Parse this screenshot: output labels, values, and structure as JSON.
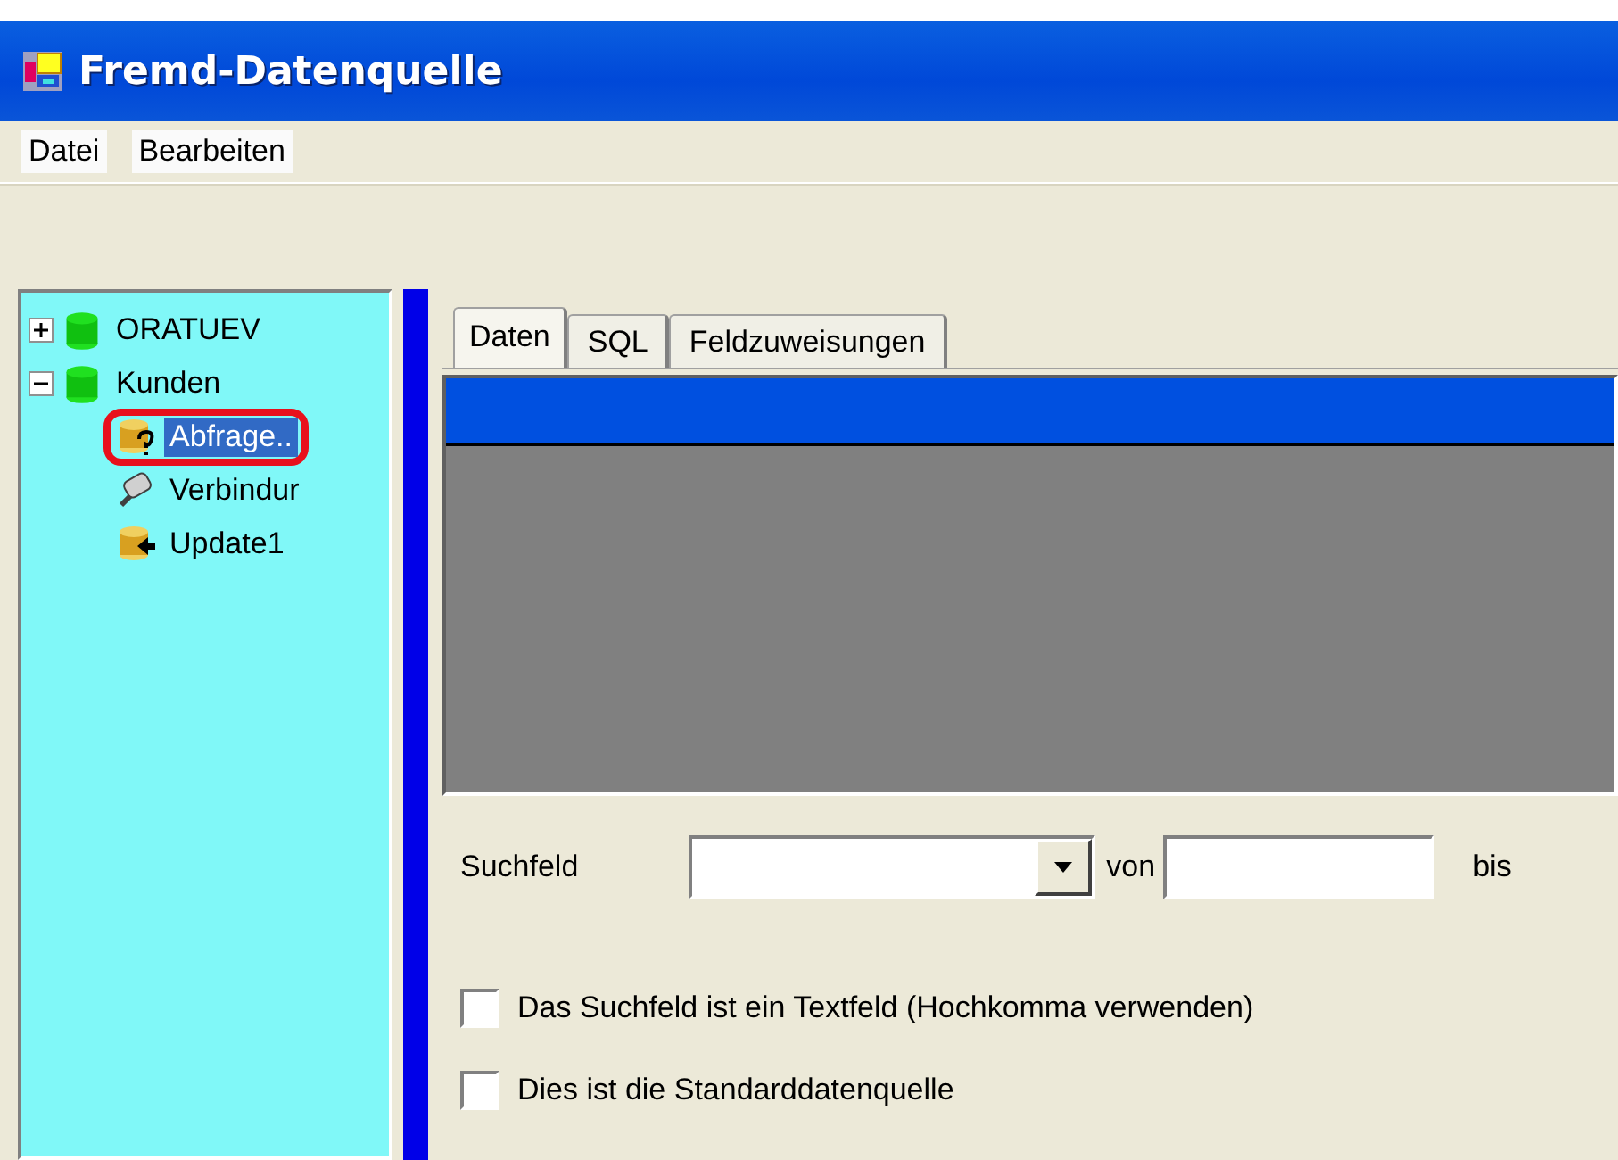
{
  "window": {
    "title": "Fremd-Datenquelle"
  },
  "menu": [
    "Datei",
    "Bearbeiten"
  ],
  "tree": [
    {
      "label": "ORATUEV",
      "kind": "database",
      "expanded": false,
      "selected": false
    },
    {
      "label": "Kunden",
      "kind": "database",
      "expanded": true,
      "selected": false,
      "children": [
        {
          "label": "Abfrage..",
          "kind": "query",
          "selected": true,
          "circled": true
        },
        {
          "label": "Verbindur",
          "kind": "connection",
          "selected": false,
          "circled": false
        },
        {
          "label": "Update1",
          "kind": "update",
          "selected": false,
          "circled": false
        }
      ]
    }
  ],
  "tabs": [
    {
      "label": "Daten",
      "selected": true
    },
    {
      "label": "SQL",
      "selected": false
    },
    {
      "label": "Feldzuweisungen",
      "selected": false
    }
  ],
  "search": {
    "label": "Suchfeld",
    "from_label": "von",
    "to_label": "bis"
  },
  "options": [
    {
      "label": "Das Suchfeld ist ein Textfeld (Hochkomma verwenden)",
      "checked": false
    },
    {
      "label": "Dies ist die Standarddatenquelle",
      "checked": false
    }
  ]
}
